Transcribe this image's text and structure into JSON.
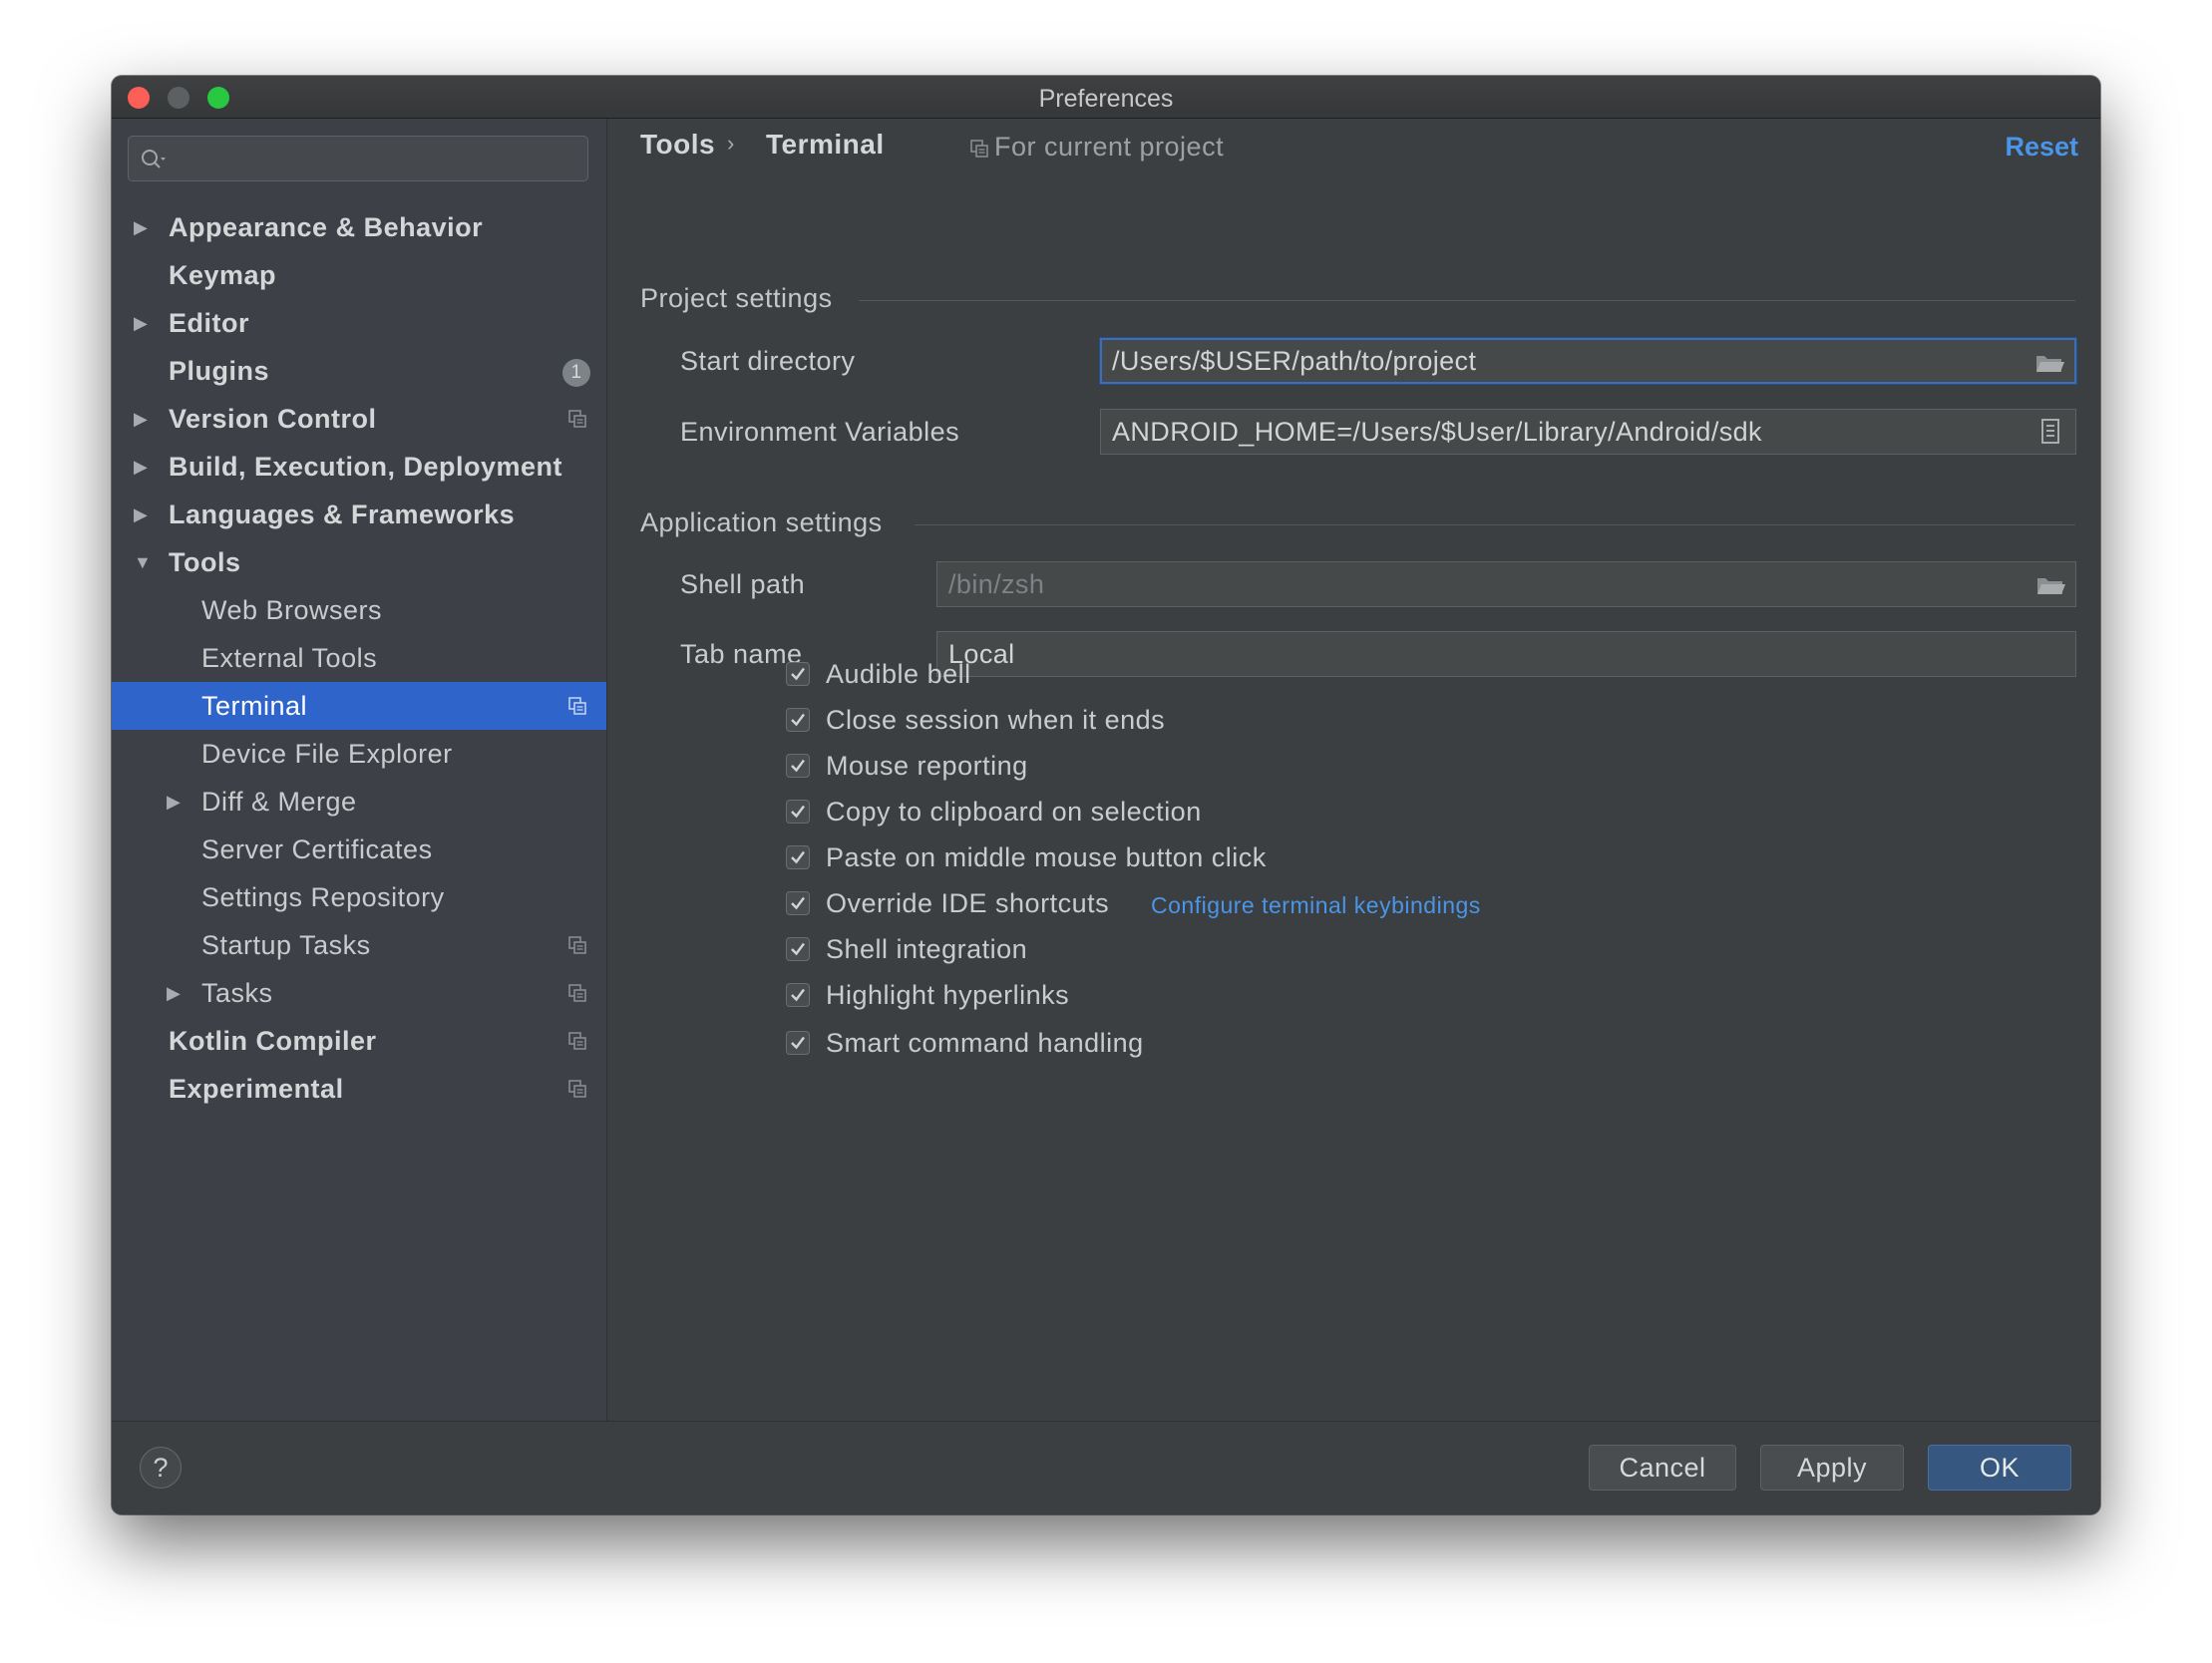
{
  "window": {
    "title": "Preferences"
  },
  "search": {
    "placeholder": ""
  },
  "sidebar": {
    "items": [
      {
        "label": "Appearance & Behavior",
        "arrow": "▶"
      },
      {
        "label": "Keymap"
      },
      {
        "label": "Editor",
        "arrow": "▶"
      },
      {
        "label": "Plugins",
        "badge": "1"
      },
      {
        "label": "Version Control",
        "arrow": "▶"
      },
      {
        "label": "Build, Execution, Deployment",
        "arrow": "▶"
      },
      {
        "label": "Languages & Frameworks",
        "arrow": "▶"
      },
      {
        "label": "Tools",
        "arrow": "▼"
      },
      {
        "label": "Web Browsers"
      },
      {
        "label": "External Tools"
      },
      {
        "label": "Terminal"
      },
      {
        "label": "Device File Explorer"
      },
      {
        "label": "Diff & Merge",
        "arrow": "▶"
      },
      {
        "label": "Server Certificates"
      },
      {
        "label": "Settings Repository"
      },
      {
        "label": "Startup Tasks"
      },
      {
        "label": "Tasks",
        "arrow": "▶"
      },
      {
        "label": "Kotlin Compiler"
      },
      {
        "label": "Experimental"
      }
    ],
    "selected": "Terminal"
  },
  "header": {
    "breadcrumb_parent": "Tools",
    "breadcrumb_sep": "›",
    "breadcrumb_current": "Terminal",
    "scope": "For current project",
    "reset": "Reset"
  },
  "project_settings": {
    "title": "Project settings",
    "start_directory_label": "Start directory",
    "start_directory_value": "/Users/$USER/path/to/project",
    "env_vars_label": "Environment Variables",
    "env_vars_value": "ANDROID_HOME=/Users/$User/Library/Android/sdk"
  },
  "app_settings": {
    "title": "Application settings",
    "shell_path_label": "Shell path",
    "shell_path_value": "/bin/zsh",
    "tab_name_label": "Tab name",
    "tab_name_value": "Local",
    "checkboxes": [
      {
        "label": "Audible bell",
        "checked": true
      },
      {
        "label": "Close session when it ends",
        "checked": true
      },
      {
        "label": "Mouse reporting",
        "checked": true
      },
      {
        "label": "Copy to clipboard on selection",
        "checked": true
      },
      {
        "label": "Paste on middle mouse button click",
        "checked": true
      },
      {
        "label": "Override IDE shortcuts",
        "checked": true
      },
      {
        "label": "Shell integration",
        "checked": true
      },
      {
        "label": "Highlight hyperlinks",
        "checked": true
      },
      {
        "label": "Smart command handling",
        "checked": true
      }
    ],
    "keybindings_link": "Configure terminal keybindings"
  },
  "footer": {
    "help": "?",
    "cancel": "Cancel",
    "apply": "Apply",
    "ok": "OK"
  },
  "colors": {
    "accent": "#2f65ca",
    "link": "#4a95e8",
    "sidebar_bg": "#3d4147",
    "panel_bg": "#3c3f41"
  }
}
